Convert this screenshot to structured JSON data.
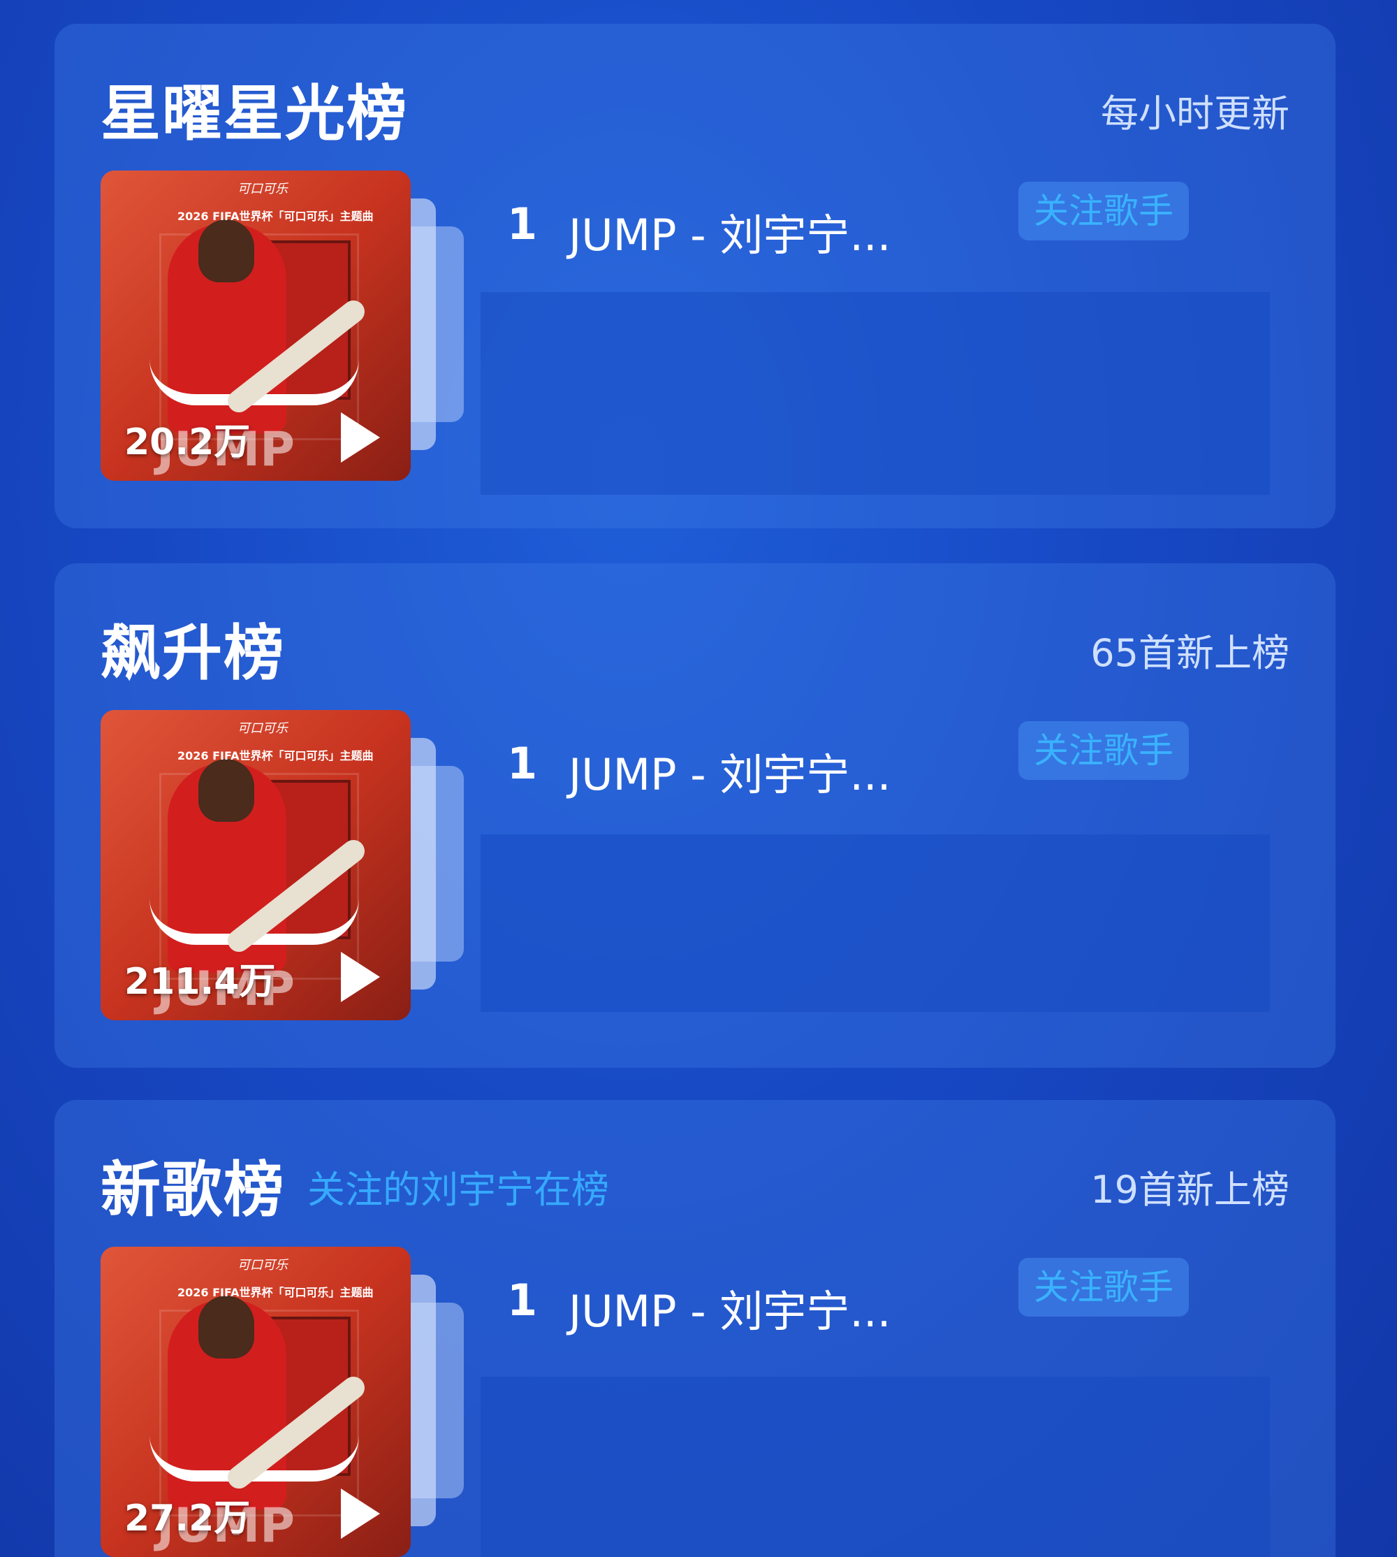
{
  "charts": [
    {
      "title": "星曜星光榜",
      "subtitle": "",
      "meta": "每小时更新",
      "play_count": "20.2万",
      "rank": "1",
      "song": "JUMP - 刘宇宁...",
      "follow_label": "关注歌手"
    },
    {
      "title": "飙升榜",
      "subtitle": "",
      "meta": "65首新上榜",
      "play_count": "211.4万",
      "rank": "1",
      "song": "JUMP - 刘宇宁...",
      "follow_label": "关注歌手"
    },
    {
      "title": "新歌榜",
      "subtitle": "关注的刘宇宁在榜",
      "meta": "19首新上榜",
      "play_count": "27.2万",
      "rank": "1",
      "song": "JUMP - 刘宇宁...",
      "follow_label": "关注歌手"
    }
  ],
  "cover": {
    "brand": "可口可乐",
    "line": "2026 FIFA世界杯「可口可乐」主题曲",
    "word": "JUMP"
  },
  "colors": {
    "background": "#1748c4",
    "accent": "#36a9ff",
    "cover": "#c7331f"
  }
}
